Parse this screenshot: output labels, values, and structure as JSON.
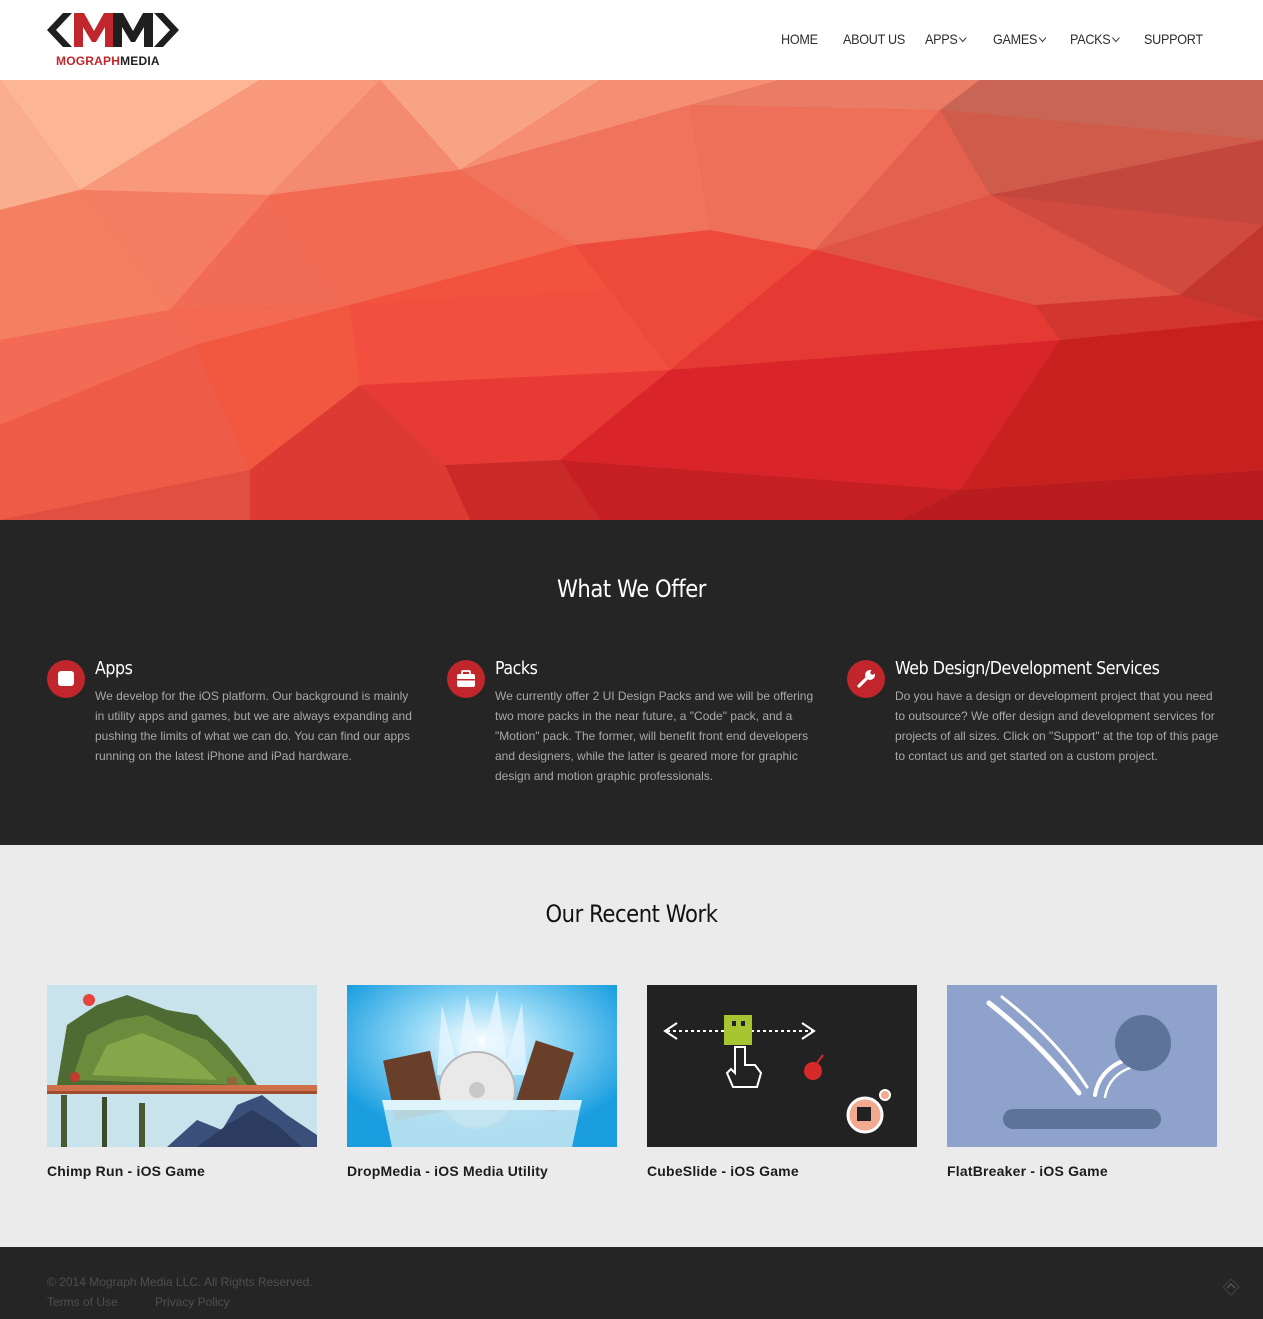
{
  "brand": {
    "name_part1": "MOGRAPH",
    "name_part2": "MEDIA",
    "accent": "#c0262b",
    "dark": "#252525"
  },
  "nav": {
    "items": [
      {
        "label": "HOME",
        "has_dropdown": false
      },
      {
        "label": "ABOUT US",
        "has_dropdown": false
      },
      {
        "label": "APPS",
        "has_dropdown": true
      },
      {
        "label": "GAMES",
        "has_dropdown": true
      },
      {
        "label": "PACKS",
        "has_dropdown": true
      },
      {
        "label": "SUPPORT",
        "has_dropdown": false
      }
    ]
  },
  "offer": {
    "title": "What We Offer",
    "features": [
      {
        "icon": "square-app-icon",
        "title": "Apps",
        "text": "We develop for the iOS platform. Our background is mainly in utility apps and games, but we are always expanding and pushing the limits of what we can do. You can find our apps running on the latest iPhone and iPad hardware."
      },
      {
        "icon": "briefcase-icon",
        "title": "Packs",
        "text": "We currently offer 2 UI Design Packs and we will be offering two more packs in the near future, a \"Code\" pack, and a \"Motion\" pack. The former, will benefit front end developers and designers, while the latter is geared more for graphic design and motion graphic professionals."
      },
      {
        "icon": "wrench-icon",
        "title": "Web Design/Development Services",
        "text": "Do you have a design or development project that you need to outsource? We offer design and development services for projects of all sizes. Click on \"Support\" at the top of this page to contact us and get started on a custom project."
      }
    ]
  },
  "work": {
    "title": "Our Recent Work",
    "items": [
      {
        "title": "Chimp Run - iOS Game"
      },
      {
        "title": "DropMedia - iOS Media Utility"
      },
      {
        "title": "CubeSlide - iOS Game"
      },
      {
        "title": "FlatBreaker - iOS Game"
      }
    ]
  },
  "footer": {
    "copyright": "© 2014 Mograph Media LLC. All Rights Reserved.",
    "links": [
      "Terms of Use",
      "Privacy Policy"
    ]
  }
}
